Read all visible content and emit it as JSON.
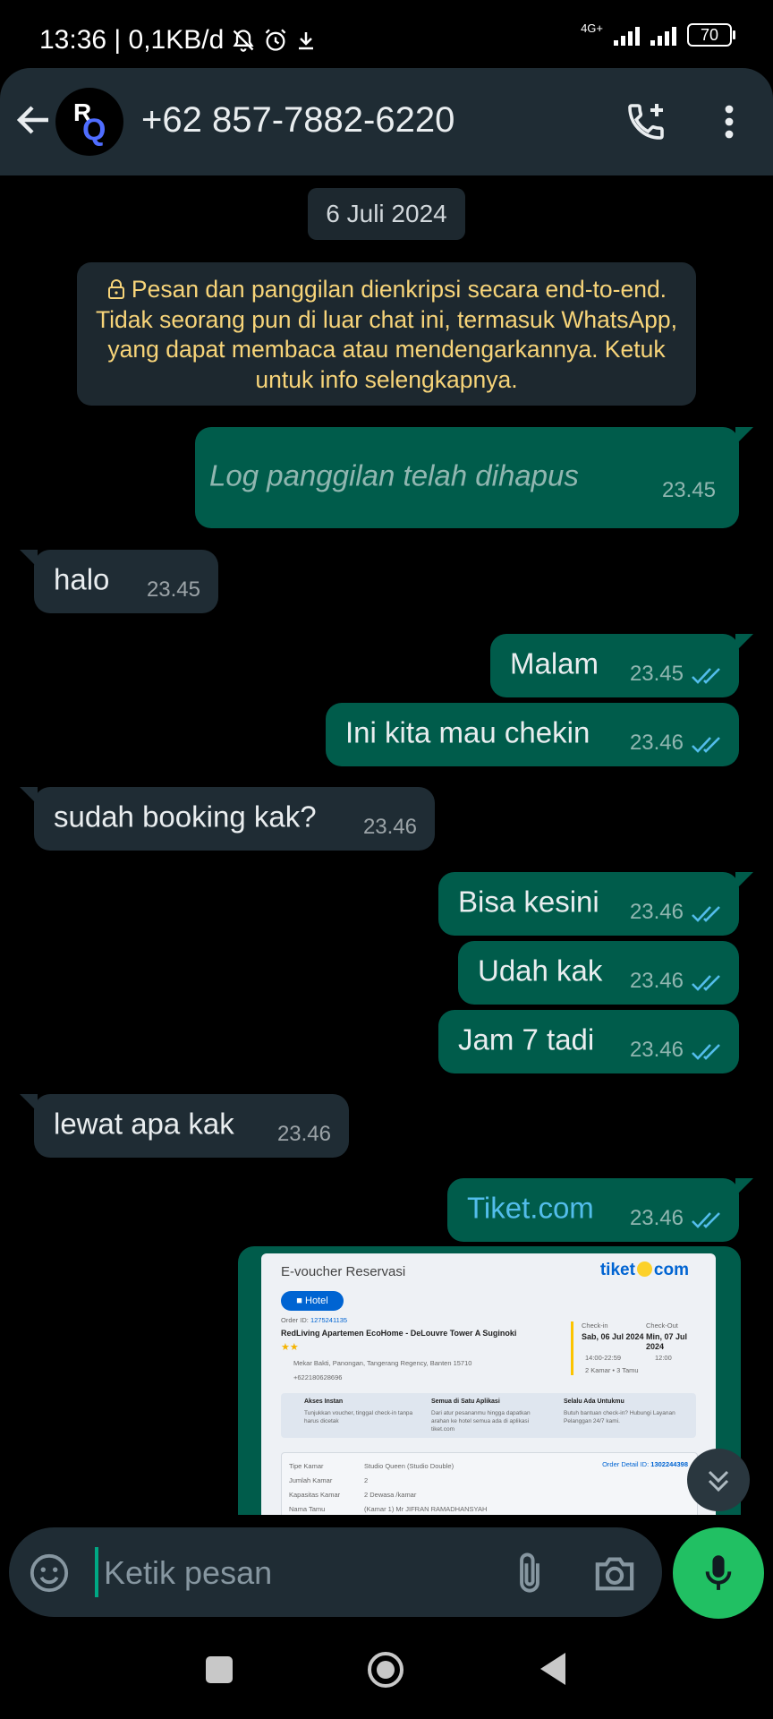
{
  "status_bar": {
    "time_info": "13:36 | 0,1KB/d",
    "network": "4G+",
    "battery": "70",
    "icons": [
      "muted-bell-icon",
      "alarm-icon",
      "download-icon",
      "signal-icon",
      "battery-icon"
    ]
  },
  "header": {
    "contact": "+62 857-7882-6220",
    "avatar_letters": [
      "R",
      "Q"
    ],
    "icons": [
      "back-arrow-icon",
      "add-call-icon",
      "more-vert-icon"
    ]
  },
  "date_chip": "6 Juli 2024",
  "encryption_notice": "Pesan dan panggilan dienkripsi secara end-to-end. Tidak seorang pun di luar chat ini, termasuk WhatsApp, yang dapat membaca atau mendengarkannya. Ketuk untuk info selengkapnya.",
  "messages": [
    {
      "text": "Log panggilan telah dihapus",
      "time": "23.45",
      "direction": "out"
    },
    {
      "text": "halo",
      "time": "23.45",
      "direction": "in"
    },
    {
      "text": "Malam",
      "time": "23.45",
      "direction": "out",
      "status": "read"
    },
    {
      "text": "Ini kita mau chekin",
      "time": "23.46",
      "direction": "out",
      "status": "read"
    },
    {
      "text": "sudah booking kak?",
      "time": "23.46",
      "direction": "in"
    },
    {
      "text": "Bisa kesini",
      "time": "23.46",
      "direction": "out",
      "status": "read"
    },
    {
      "text": "Udah kak",
      "time": "23.46",
      "direction": "out",
      "status": "read"
    },
    {
      "text": "Jam 7 tadi",
      "time": "23.46",
      "direction": "out",
      "status": "read"
    },
    {
      "text": "lewat apa kak",
      "time": "23.46",
      "direction": "in"
    },
    {
      "text": "Tiket.com",
      "time": "23.46",
      "direction": "out",
      "status": "read",
      "is_link": true
    }
  ],
  "voucher": {
    "title": "E-voucher Reservasi",
    "logo_left": "tiket",
    "logo_right": "com",
    "category": "Hotel",
    "order_id_label": "Order ID:",
    "order_id": "1275241135",
    "hotel_name": "RedLiving Apartemen EcoHome - DeLouvre Tower A Suginoki",
    "address": "Mekar Bakti, Panongan, Tangerang Regency, Banten 15710",
    "phone": "+622180628696",
    "checkin_label": "Check-in",
    "checkin_date": "Sab, 06 Jul 2024",
    "checkin_time": "14:00-22:59",
    "checkout_label": "Check-Out",
    "checkout_date": "Min, 07 Jul 2024",
    "checkout_time": "12:00",
    "rooms_guests": "2 Kamar • 3 Tamu",
    "info": [
      {
        "title": "Akses Instan",
        "body": "Tunjukkan voucher, tinggal check-in tanpa harus dicetak"
      },
      {
        "title": "Semua di Satu Aplikasi",
        "body": "Dari atur pesananmu hingga dapatkan arahan ke hotel semua ada di aplikasi tiket.com"
      },
      {
        "title": "Selalu Ada Untukmu",
        "body": "Butuh bantuan check-in? Hubungi Layanan Pelanggan 24/7 kami."
      }
    ],
    "order_detail_label": "Order Detail ID:",
    "order_detail_id": "1302244398",
    "rows": [
      {
        "label": "Tipe Kamar",
        "value": "Studio Queen (Studio Double)"
      },
      {
        "label": "Jumlah Kamar",
        "value": "2"
      },
      {
        "label": "Kapasitas Kamar",
        "value": "2 Dewasa /kamar"
      },
      {
        "label": "Nama Tamu",
        "value": "(Kamar 1) Mr JIFRAN RAMADHANSYAH"
      }
    ]
  },
  "input": {
    "placeholder": "Ketik pesan",
    "icons": [
      "emoji-icon",
      "attach-icon",
      "camera-icon",
      "mic-icon",
      "double-chevron-down-icon"
    ]
  },
  "colors": {
    "background": "#000000",
    "header": "#1f2c34",
    "outgoing_bubble": "#005c4b",
    "incoming_bubble": "#1f2c34",
    "notice_text": "#f7d479",
    "read_ticks": "#53bdeb",
    "mic_button": "#21c063",
    "link": "#53bdeb"
  }
}
